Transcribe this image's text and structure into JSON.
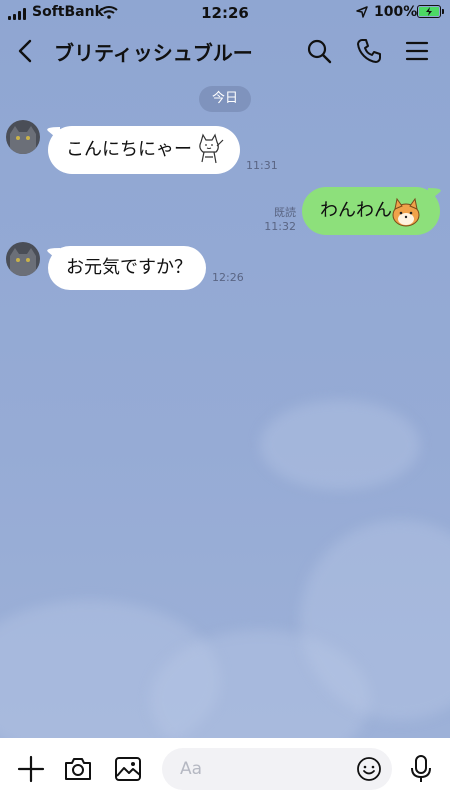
{
  "status_bar": {
    "carrier": "SoftBank",
    "time": "12:26",
    "battery": "100%"
  },
  "header": {
    "title": "ブリティッシュブルー",
    "icons": [
      "back-chevron-icon",
      "search-icon",
      "phone-icon",
      "menu-icon"
    ]
  },
  "chat": {
    "date_label": "今日",
    "messages": [
      {
        "side": "in",
        "text": "こんにちにゃー",
        "time": "11:31",
        "sticker": "cat-sticker"
      },
      {
        "side": "out",
        "text": "わんわん",
        "time": "11:32",
        "read": "既読",
        "sticker": "dog-sticker"
      },
      {
        "side": "in",
        "text": "お元気ですか？",
        "time": "12:26"
      }
    ]
  },
  "input_bar": {
    "placeholder": "Aa",
    "icons": [
      "plus-icon",
      "camera-icon",
      "image-icon",
      "emoji-icon",
      "microphone-icon"
    ]
  },
  "colors": {
    "background": "#93a9d4",
    "incoming_bubble": "#ffffff",
    "outgoing_bubble": "#8de07b",
    "date_pill": "#7f93bd"
  }
}
